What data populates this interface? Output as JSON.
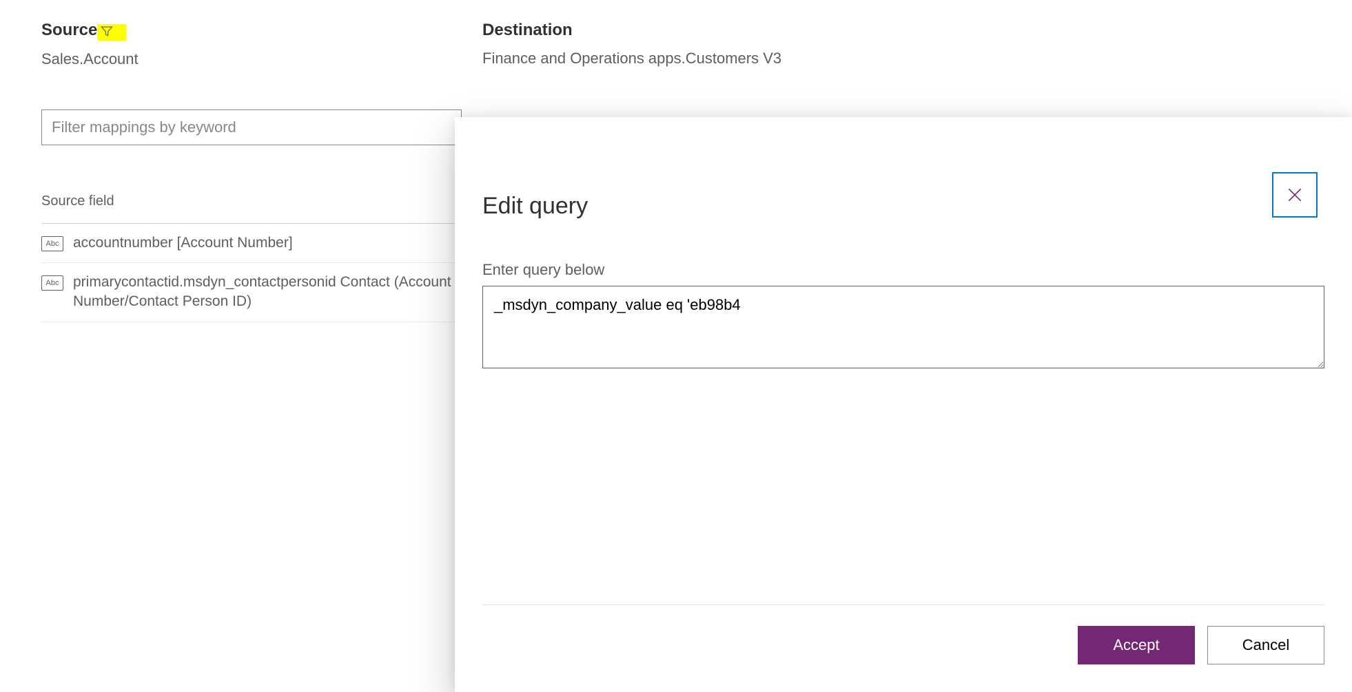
{
  "header": {
    "source_label": "Source",
    "source_value": "Sales.Account",
    "destination_label": "Destination",
    "destination_value": "Finance and Operations apps.Customers V3"
  },
  "filter": {
    "placeholder": "Filter mappings by keyword"
  },
  "table": {
    "source_field_header": "Source field",
    "rows": [
      {
        "field": "accountnumber [Account Number]"
      },
      {
        "field": "primarycontactid.msdyn_contactpersonid Contact (Account Number/Contact Person ID)"
      }
    ]
  },
  "dialog": {
    "title": "Edit query",
    "label": "Enter query below",
    "value": "_msdyn_company_value eq 'eb98b4",
    "accept": "Accept",
    "cancel": "Cancel"
  },
  "icons": {
    "abc_text": "Abc"
  }
}
